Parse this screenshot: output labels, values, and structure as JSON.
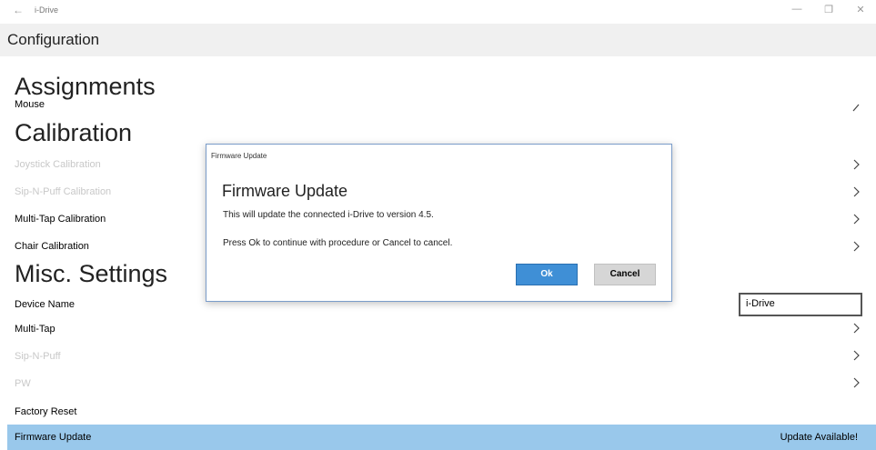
{
  "window": {
    "back_glyph": "←",
    "title": "i-Drive",
    "minimize_glyph": "—",
    "restore_glyph": "❐",
    "close_glyph": "✕"
  },
  "page": {
    "title": "Configuration"
  },
  "sections": {
    "assignments": {
      "heading": "Assignments",
      "items": [
        {
          "label": "Mouse"
        }
      ]
    },
    "calibration": {
      "heading": "Calibration",
      "items": [
        {
          "label": "Joystick Calibration"
        },
        {
          "label": "Sip-N-Puff Calibration"
        },
        {
          "label": "Multi-Tap Calibration"
        },
        {
          "label": "Chair Calibration"
        }
      ]
    },
    "misc": {
      "heading": "Misc. Settings",
      "device_name_label": "Device Name",
      "device_name_value": "i-Drive",
      "items": [
        {
          "label": "Multi-Tap"
        },
        {
          "label": "Sip-N-Puff"
        },
        {
          "label": "PW"
        },
        {
          "label": "Factory Reset"
        }
      ],
      "firmware": {
        "label": "Firmware Update",
        "status": "Update Available!"
      }
    }
  },
  "dialog": {
    "title": "Firmware Update",
    "heading": "Firmware Update",
    "message1": "This will update the connected i-Drive to version 4.5.",
    "message2": "Press Ok to continue with procedure or Cancel to cancel.",
    "ok_label": "Ok",
    "cancel_label": "Cancel"
  },
  "colors": {
    "highlight": "#99c8eb",
    "ok_button": "#3f8fd6",
    "dim_text": "#c8c8c8"
  }
}
